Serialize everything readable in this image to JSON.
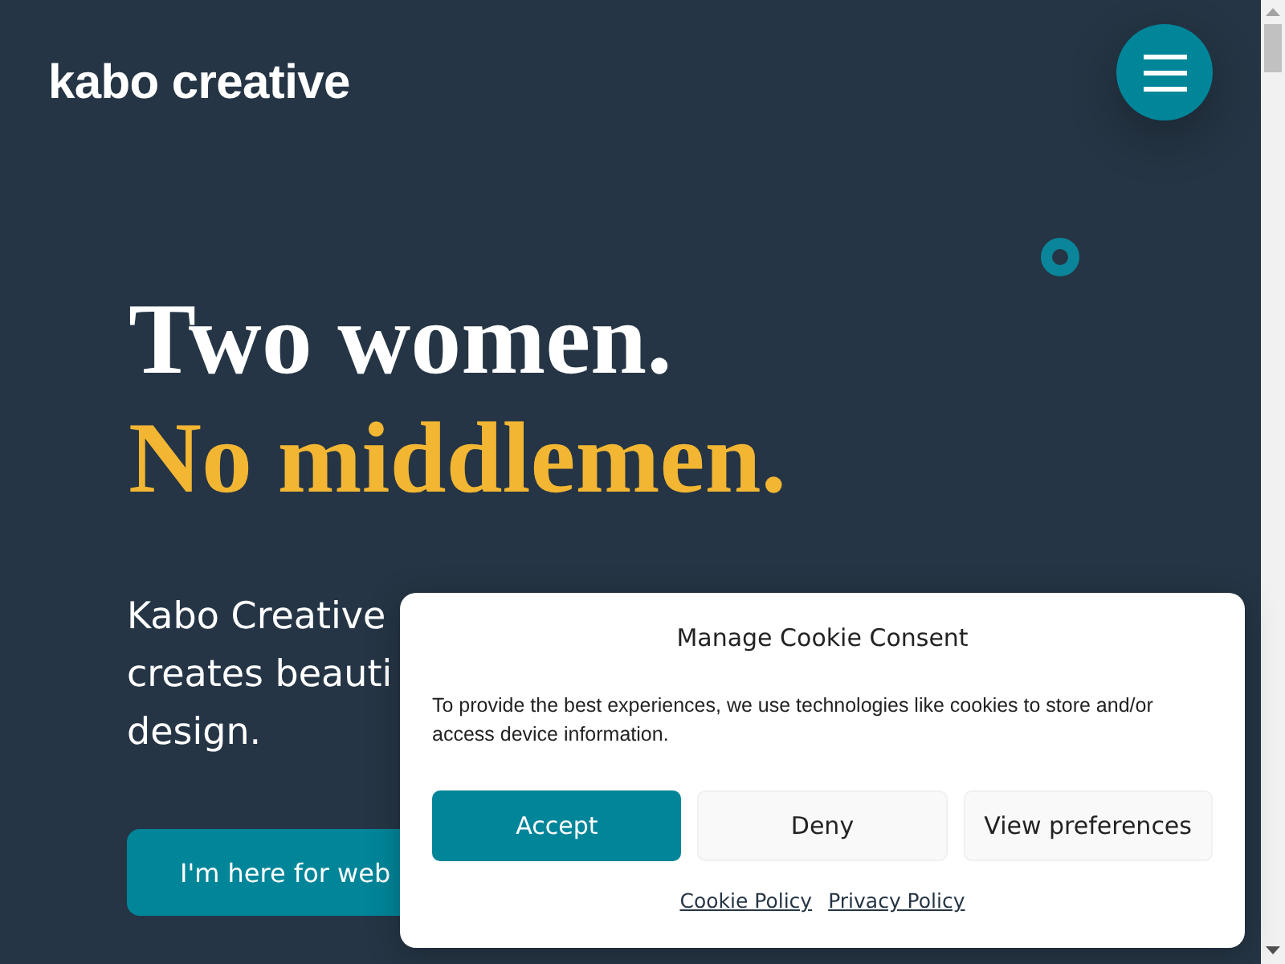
{
  "header": {
    "logo": "kabo creative"
  },
  "hero": {
    "headline": [
      {
        "text": "Two women.",
        "kind": "plain"
      },
      {
        "text": "No middlemen.",
        "kind": "accent"
      }
    ],
    "description_lines": [
      "Kabo Creative",
      "creates beauti",
      "design."
    ],
    "cta_button": "I'm here for web"
  },
  "cookie_dialog": {
    "title": "Manage Cookie Consent",
    "message": "To provide the best experiences, we use technologies like cookies to store and/or access device information.",
    "buttons": [
      {
        "label": "Accept",
        "kind": "primary"
      },
      {
        "label": "Deny",
        "kind": "secondary"
      },
      {
        "label": "View preferences",
        "kind": "secondary"
      }
    ],
    "links": [
      "Cookie Policy",
      "Privacy Policy"
    ]
  }
}
